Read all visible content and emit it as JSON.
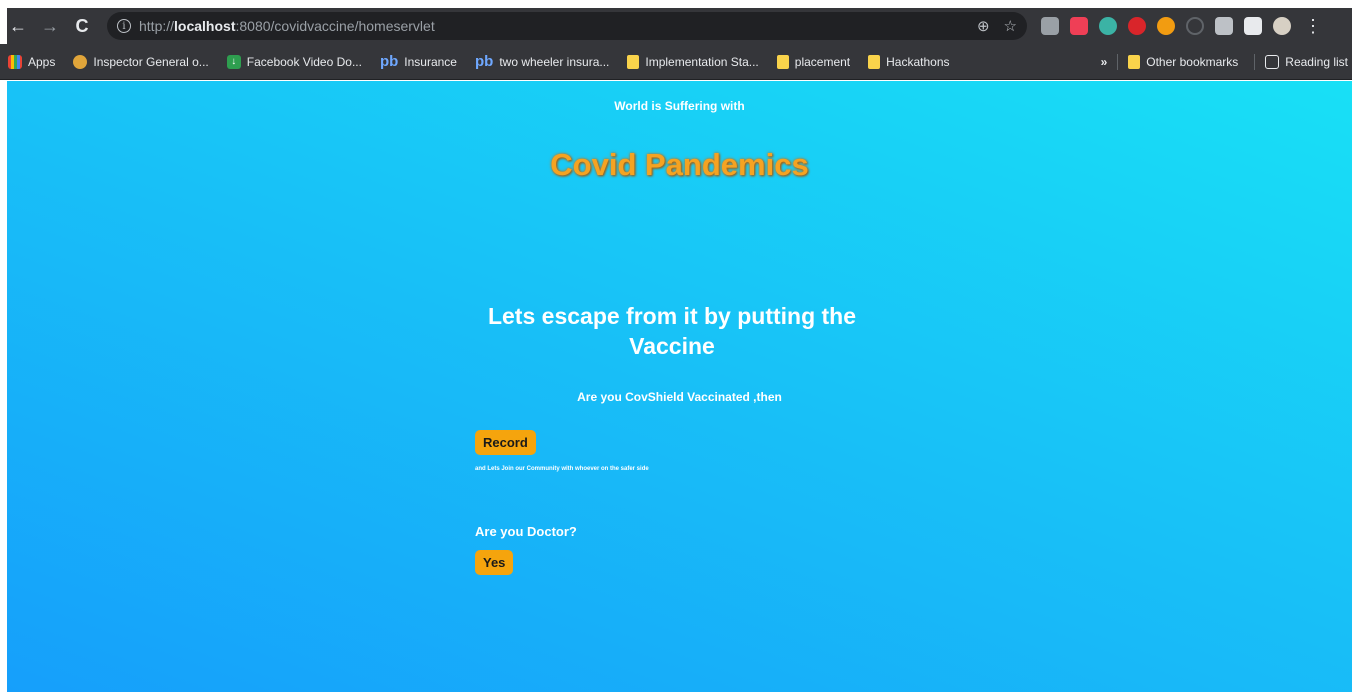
{
  "browser": {
    "url_prefix": "http://",
    "url_host": "localhost",
    "url_rest": ":8080/covidvaccine/homeservlet",
    "back": "←",
    "forward": "→",
    "reload": "C",
    "zoom_icon": "⊕",
    "star_icon": "☆",
    "menu_icon": "⋮"
  },
  "bookmarks": {
    "apps": "Apps",
    "items": [
      {
        "label": "Inspector General o..."
      },
      {
        "label": "Facebook Video Do..."
      },
      {
        "label": "Insurance"
      },
      {
        "label": "two wheeler insura..."
      },
      {
        "label": "Implementation Sta..."
      },
      {
        "label": "placement"
      },
      {
        "label": "Hackathons"
      }
    ],
    "more": "»",
    "other": "Other bookmarks",
    "reading": "Reading list",
    "pb_glyph": "pb"
  },
  "page": {
    "subheading": "World is Suffering with",
    "heading": "Covid Pandemics",
    "tagline": "Lets escape from it by putting the Vaccine",
    "question": "Are you CovShield Vaccinated ,then",
    "record_label": "Record",
    "note": "and Lets Join our Community with whoever on the safer side",
    "doctor_question": "Are you Doctor?",
    "yes_label": "Yes"
  }
}
